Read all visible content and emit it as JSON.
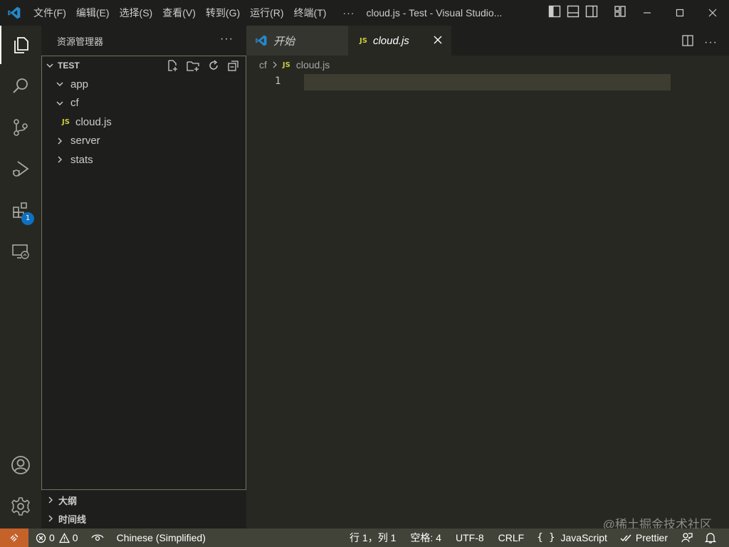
{
  "titlebar": {
    "menu": [
      "文件(F)",
      "编辑(E)",
      "选择(S)",
      "查看(V)",
      "转到(G)",
      "运行(R)",
      "终端(T)"
    ],
    "more": "···",
    "title": "cloud.js - Test - Visual Studio..."
  },
  "activitybar": {
    "items": [
      "files-icon",
      "search-icon",
      "source-control-icon",
      "run-debug-icon",
      "extensions-icon",
      "remote-explorer-icon"
    ],
    "extensions_badge": "1",
    "bottom": [
      "account-icon",
      "settings-gear-icon"
    ]
  },
  "sidebar": {
    "title": "资源管理器",
    "more": "···",
    "workspace": "TEST",
    "tree": [
      {
        "label": "app",
        "type": "folder",
        "expanded": true,
        "depth": 0
      },
      {
        "label": "cf",
        "type": "folder",
        "expanded": true,
        "depth": 0
      },
      {
        "label": "cloud.js",
        "type": "file",
        "icon": "JS",
        "depth": 1
      },
      {
        "label": "server",
        "type": "folder",
        "expanded": false,
        "depth": 0
      },
      {
        "label": "stats",
        "type": "folder",
        "expanded": false,
        "depth": 0
      }
    ],
    "outline": "大纲",
    "timeline": "时间线"
  },
  "tabs": [
    {
      "label": "开始",
      "active": false
    },
    {
      "label": "cloud.js",
      "icon": "JS",
      "active": true
    }
  ],
  "breadcrumb": {
    "folder": "cf",
    "file_icon": "JS",
    "file": "cloud.js"
  },
  "editor": {
    "line_numbers": [
      "1"
    ],
    "watermark": "@稀土掘金技术社区"
  },
  "statusbar": {
    "errors": "0",
    "warnings": "0",
    "language_pack": "Chinese (Simplified)",
    "position": "行 1，列 1",
    "spaces": "空格: 4",
    "encoding": "UTF-8",
    "eol": "CRLF",
    "language": "JavaScript",
    "formatter": "Prettier"
  },
  "colors": {
    "accent_remote": "#c4622a",
    "badge": "#0e70c0",
    "js_icon": "#cbcb41",
    "vscode_logo": "#2489ca"
  }
}
